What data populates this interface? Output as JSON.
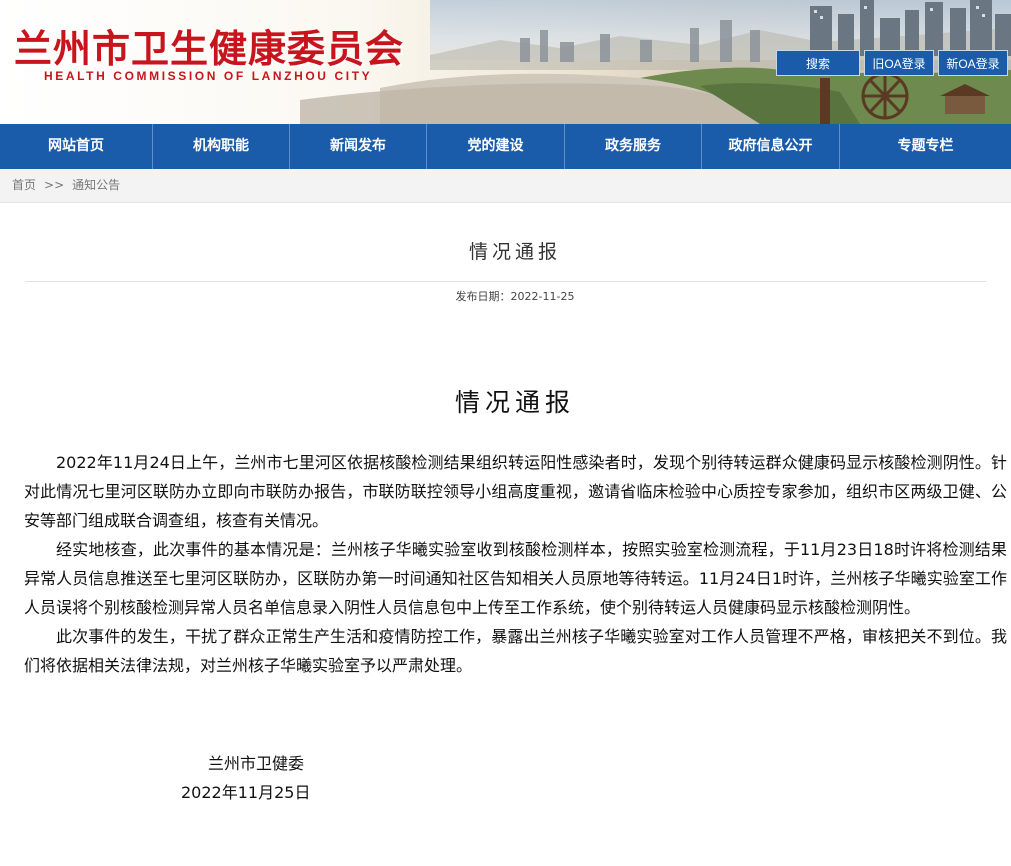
{
  "header": {
    "logo_cn": "兰州市卫生健康委员会",
    "logo_en": "HEALTH COMMISSION OF LANZHOU CITY",
    "buttons": {
      "search": "搜索",
      "oa_old": "旧OA登录",
      "oa_new": "新OA登录"
    }
  },
  "nav": {
    "items": [
      "网站首页",
      "机构职能",
      "新闻发布",
      "党的建设",
      "政务服务",
      "政府信息公开",
      "专题专栏"
    ]
  },
  "breadcrumb": {
    "home": "首页",
    "separator": ">>",
    "current": "通知公告"
  },
  "article": {
    "title": "情况通报",
    "date": "发布日期：2022-11-25",
    "body_title": "情况通报",
    "paragraphs": [
      "2022年11月24日上午，兰州市七里河区依据核酸检测结果组织转运阳性感染者时，发现个别待转运群众健康码显示核酸检测阴性。针对此情况七里河区联防办立即向市联防办报告，市联防联控领导小组高度重视，邀请省临床检验中心质控专家参加，组织市区两级卫健、公安等部门组成联合调查组，核查有关情况。",
      "经实地核查，此次事件的基本情况是：兰州核子华曦实验室收到核酸检测样本，按照实验室检测流程，于11月23日18时许将检测结果异常人员信息推送至七里河区联防办，区联防办第一时间通知社区告知相关人员原地等待转运。11月24日1时许，兰州核子华曦实验室工作人员误将个别核酸检测异常人员名单信息录入阴性人员信息包中上传至工作系统，使个别待转运人员健康码显示核酸检测阴性。",
      "此次事件的发生，干扰了群众正常生产生活和疫情防控工作，暴露出兰州核子华曦实验室对工作人员管理不严格，审核把关不到位。我们将依据相关法律法规，对兰州核子华曦实验室予以严肃处理。"
    ],
    "signature_org": "兰州市卫健委",
    "signature_date": "2022年11月25日"
  },
  "colors": {
    "brand_red": "#c8151d",
    "nav_blue": "#1a5ca9"
  }
}
